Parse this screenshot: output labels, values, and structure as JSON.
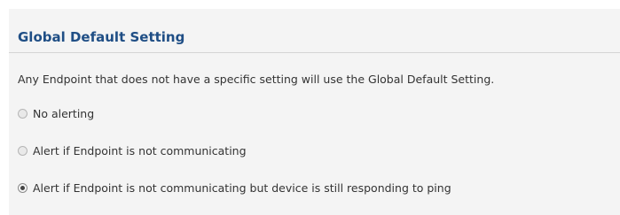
{
  "section": {
    "title": "Global Default Setting",
    "description": "Any Endpoint that does not have a specific setting will use the Global Default Setting."
  },
  "options": [
    {
      "label": "No alerting",
      "checked": false
    },
    {
      "label": "Alert if Endpoint is not communicating",
      "checked": false
    },
    {
      "label": "Alert if Endpoint is not communicating but device is still responding to ping",
      "checked": true
    }
  ],
  "colors": {
    "title": "#1f4e85",
    "panel_background": "#f4f4f4",
    "text": "#333333"
  }
}
